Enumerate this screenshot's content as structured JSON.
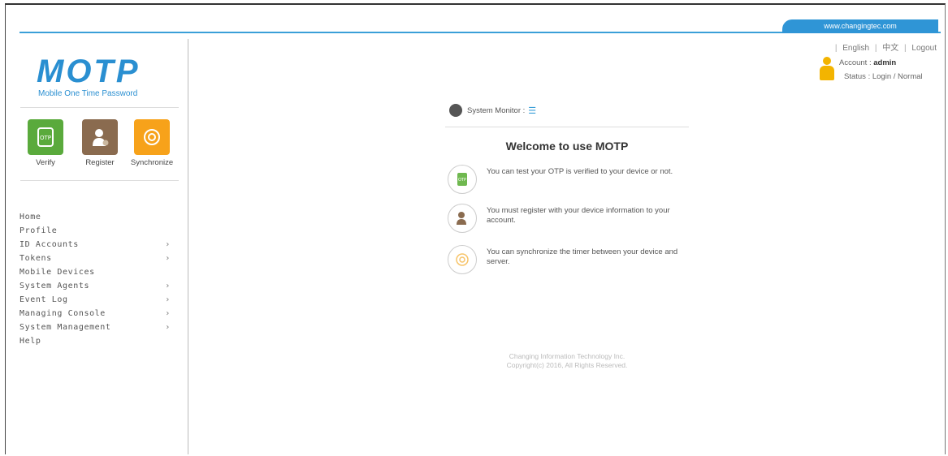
{
  "header": {
    "url": "www.changingtec.com",
    "links": [
      "English",
      "中文",
      "Logout"
    ],
    "account_label": "Account :",
    "account_value": "admin",
    "status_label": "Status :",
    "status_value": "Login / Normal"
  },
  "brand": {
    "name": "MOTP",
    "tagline": "Mobile One Time Password",
    "color": "#2a8fd1"
  },
  "quick_actions": [
    {
      "label": "Verify",
      "icon": "otp-phone-icon",
      "color": "#5aaa3c"
    },
    {
      "label": "Register",
      "icon": "user-register-icon",
      "color": "#8a6b4f"
    },
    {
      "label": "Synchronize",
      "icon": "sync-icon",
      "color": "#f7a21a"
    }
  ],
  "menu": [
    {
      "label": "Home",
      "has_arrow": false
    },
    {
      "label": "Profile",
      "has_arrow": false
    },
    {
      "label": "ID Accounts",
      "has_arrow": true
    },
    {
      "label": "Tokens",
      "has_arrow": true
    },
    {
      "label": "Mobile Devices",
      "has_arrow": false
    },
    {
      "label": "System Agents",
      "has_arrow": true
    },
    {
      "label": "Event Log",
      "has_arrow": true
    },
    {
      "label": "Managing Console",
      "has_arrow": true
    },
    {
      "label": "System Management",
      "has_arrow": true
    },
    {
      "label": "Help",
      "has_arrow": false
    }
  ],
  "main": {
    "monitor_label": "System Monitor :",
    "welcome_title": "Welcome to use MOTP",
    "features": [
      {
        "icon": "otp-phone-icon",
        "text": "You can test your OTP is verified to your device or not."
      },
      {
        "icon": "user-register-icon",
        "text": "You must register with your device information to your account."
      },
      {
        "icon": "sync-icon",
        "text": "You can synchronize the timer between your device and server."
      }
    ],
    "footer_line1": "Changing Information Technology Inc.",
    "footer_line2": "Copyright(c) 2016, All Rights Reserved."
  },
  "colors": {
    "accent_blue": "#2f95d6",
    "user_icon": "#f3b400"
  }
}
